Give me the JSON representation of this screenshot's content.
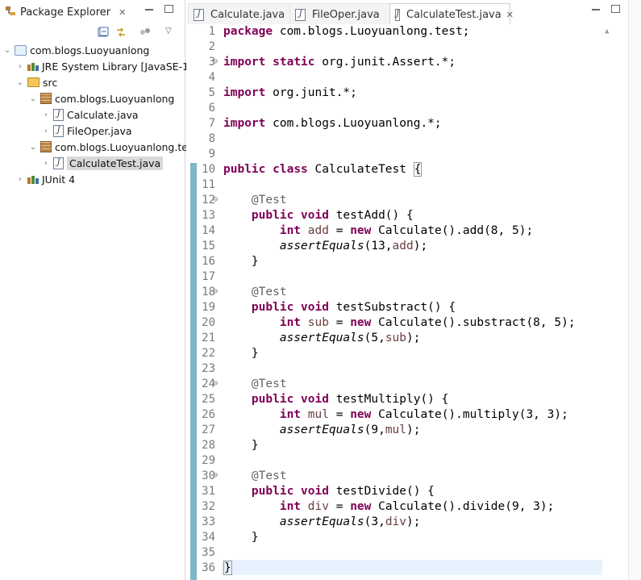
{
  "package_explorer": {
    "tab_label": "Package Explorer",
    "tree": [
      {
        "label": "com.blogs.Luoyuanlong",
        "icon": "project-icon",
        "expanded": true
      },
      {
        "label": "JRE System Library",
        "suffix": "[JavaSE-1",
        "icon": "library-icon",
        "expanded": false
      },
      {
        "label": "src",
        "icon": "source-folder-icon",
        "expanded": true
      },
      {
        "label": "com.blogs.Luoyuanlong",
        "icon": "package-icon",
        "expanded": true
      },
      {
        "label": "Calculate.java",
        "icon": "java-file-icon",
        "expanded": false
      },
      {
        "label": "FileOper.java",
        "icon": "java-file-icon",
        "expanded": false
      },
      {
        "label": "com.blogs.Luoyuanlong.te",
        "icon": "package-icon",
        "expanded": true
      },
      {
        "label": "CalculateTest.java",
        "icon": "java-file-icon",
        "expanded": false,
        "selected": true
      },
      {
        "label": "JUnit 4",
        "icon": "library-icon",
        "expanded": false
      }
    ]
  },
  "editor": {
    "tabs": [
      {
        "label": "Calculate.java",
        "active": false
      },
      {
        "label": "FileOper.java",
        "active": false
      },
      {
        "label": "CalculateTest.java",
        "active": true
      }
    ],
    "line_numbers": [
      "1",
      "2",
      "3",
      "4",
      "5",
      "6",
      "7",
      "8",
      "9",
      "10",
      "11",
      "12",
      "13",
      "14",
      "15",
      "16",
      "17",
      "18",
      "19",
      "20",
      "21",
      "22",
      "23",
      "24",
      "25",
      "26",
      "27",
      "28",
      "29",
      "30",
      "31",
      "32",
      "33",
      "34",
      "35",
      "36"
    ],
    "code": {
      "l1_kw": "package",
      "l1_rest": " com.blogs.Luoyuanlong.test;",
      "l3_kw1": "import",
      "l3_kw2": "static",
      "l3_rest": " org.junit.Assert.*;",
      "l5_kw": "import",
      "l5_rest": " org.junit.*;",
      "l7_kw": "import",
      "l7_rest": " com.blogs.Luoyuanlong.*;",
      "l10_kw1": "public",
      "l10_kw2": "class",
      "l10_name": " CalculateTest ",
      "l10_brace": "{",
      "ann": "@Test",
      "public": "public",
      "void": "void",
      "int": "int",
      "new": "new",
      "m1_name": " testAdd() {",
      "m1_var": "add",
      "m1_call": " Calculate().add(8, 5);",
      "m1_assert": "assertEquals",
      "m1_args_open": "(13,",
      "m1_args_close": ");",
      "m2_name": " testSubstract() {",
      "m2_var": "sub",
      "m2_call": " Calculate().substract(8, 5);",
      "m2_assert": "assertEquals",
      "m2_args_open": "(5,",
      "m2_args_close": ");",
      "m3_name": " testMultiply() {",
      "m3_var": "mul",
      "m3_call": " Calculate().multiply(3, 3);",
      "m3_assert": "assertEquals",
      "m3_args_open": "(9,",
      "m3_args_close": ");",
      "m4_name": " testDivide() {",
      "m4_var": "div",
      "m4_call": " Calculate().divide(9, 3);",
      "m4_assert": "assertEquals",
      "m4_args_open": "(3,",
      "m4_args_close": ");",
      "close_brace": "}",
      "eq": " = "
    },
    "folded_lines": [
      "3",
      "12",
      "18",
      "24",
      "30"
    ],
    "colors": {
      "keyword": "#7f0055",
      "annotation": "#646464",
      "field": "#6a3e3e",
      "ruler": "#7fb6c9",
      "current_line": "#e8f2fe"
    }
  }
}
